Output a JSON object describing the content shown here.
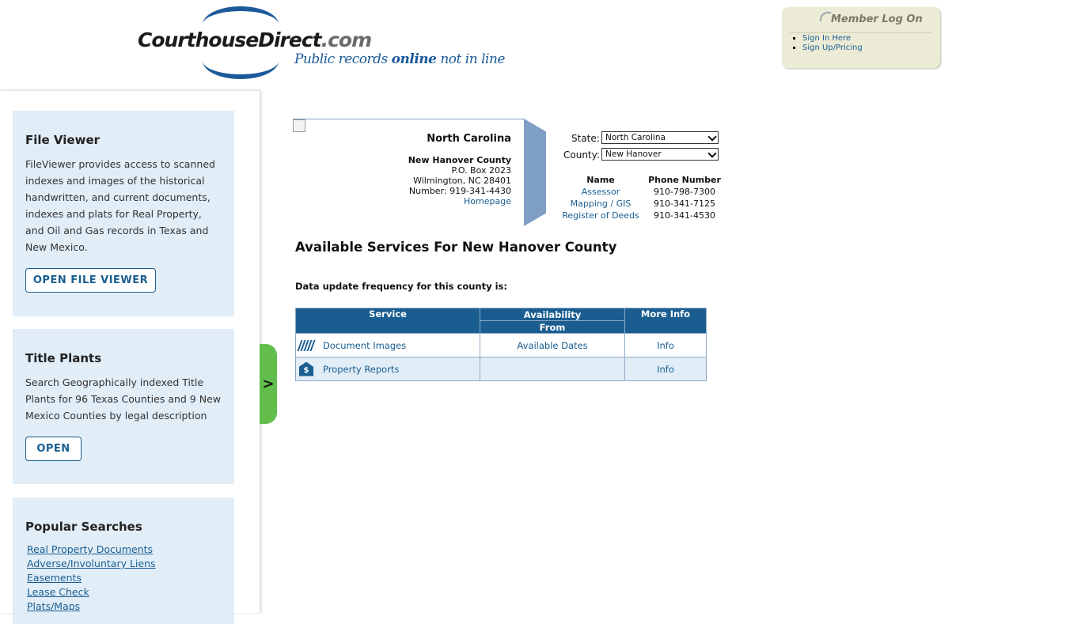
{
  "logo": {
    "word": "CourthouseDirect",
    "dotcom": ".com",
    "tag_pre": "Public records ",
    "tag_bold": "online",
    "tag_post": " not in line"
  },
  "member": {
    "title": "Member Log On",
    "links": [
      "Sign In Here",
      "Sign Up/Pricing"
    ]
  },
  "sidebar": {
    "file_viewer": {
      "title": "File Viewer",
      "text": "FileViewer provides access to scanned indexes and images of the historical handwritten, and current documents, indexes and plats for Real Property, and Oil and Gas records in Texas and New Mexico.",
      "button": "OPEN FILE VIEWER"
    },
    "title_plants": {
      "title": "Title Plants",
      "text": "Search Geographically indexed Title Plants for 96 Texas Counties and 9 New Mexico Counties by legal description",
      "button": "OPEN"
    },
    "popular": {
      "title": "Popular Searches",
      "links": [
        "Real Property Documents",
        "Adverse/Involuntary Liens",
        "Easements",
        "Lease Check",
        "Plats/Maps"
      ]
    },
    "toggle": ">"
  },
  "county": {
    "state": "North Carolina",
    "name": "New Hanover County",
    "address1": "P.O. Box 2023",
    "address2": "Wilmington, NC 28401",
    "number": "Number: 919-341-4430",
    "homepage": "Homepage"
  },
  "selectors": {
    "state_label": "State:",
    "state_value": "North Carolina",
    "county_label": "County:",
    "county_value": "New Hanover"
  },
  "contacts": {
    "name_header": "Name",
    "phone_header": "Phone Number",
    "rows": [
      {
        "name": "Assessor",
        "phone": "910-798-7300"
      },
      {
        "name": "Mapping / GIS",
        "phone": "910-341-7125"
      },
      {
        "name": "Register of Deeds",
        "phone": "910-341-4530"
      }
    ]
  },
  "services": {
    "title": "Available Services For New Hanover County",
    "frequency": "Data update frequency for this county is:",
    "headers": {
      "service": "Service",
      "availability": "Availability",
      "from": "From",
      "more": "More Info"
    },
    "rows": [
      {
        "icon": "documents-icon",
        "name": "Document Images",
        "availability": "Available Dates",
        "more": "Info"
      },
      {
        "icon": "property-report-icon",
        "name": "Property Reports",
        "availability": "",
        "more": "Info"
      }
    ]
  }
}
